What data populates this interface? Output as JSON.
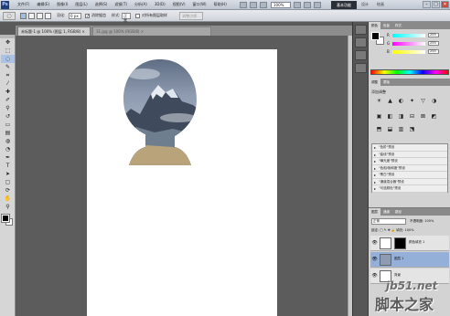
{
  "app": {
    "logo": "Ps",
    "menu": [
      "文件(F)",
      "编辑(E)",
      "图像(I)",
      "图层(L)",
      "选择(S)",
      "滤镜(T)",
      "分析(A)",
      "3D(D)",
      "视图(V)",
      "窗口(W)",
      "帮助(H)"
    ],
    "zoom": "100%",
    "workspace": "基本功能",
    "workspace_items": [
      "设计",
      "绘画"
    ],
    "window_controls": [
      "–",
      "□",
      "✕"
    ]
  },
  "options_bar": {
    "feather_label": "羽化:",
    "feather_value": "0 px",
    "antialias_label": "消除锯齿",
    "antialias_checked": true,
    "style_label": "样式:",
    "style_value": "正常",
    "autoselect_label": "对所有图层取样",
    "refine_edge": "调整边缘..."
  },
  "document_tabs": [
    {
      "label": "未标题-1 @ 100% (图层 1, RGB/8) ×",
      "active": true
    },
    {
      "label": "31.jpg @ 100% (RGB/8) ×",
      "active": false
    }
  ],
  "tools": [
    {
      "icon": "move-icon",
      "glyph": "✥"
    },
    {
      "icon": "marquee-icon",
      "glyph": "⬚"
    },
    {
      "icon": "lasso-icon",
      "glyph": "◌"
    },
    {
      "icon": "quick-select-icon",
      "glyph": "✎"
    },
    {
      "icon": "crop-icon",
      "glyph": "⌗"
    },
    {
      "icon": "eyedropper-icon",
      "glyph": "⁄"
    },
    {
      "icon": "healing-brush-icon",
      "glyph": "✚"
    },
    {
      "icon": "brush-icon",
      "glyph": "✐"
    },
    {
      "icon": "clone-stamp-icon",
      "glyph": "⚲"
    },
    {
      "icon": "history-brush-icon",
      "glyph": "↺"
    },
    {
      "icon": "eraser-icon",
      "glyph": "▭"
    },
    {
      "icon": "gradient-icon",
      "glyph": "▤"
    },
    {
      "icon": "blur-icon",
      "glyph": "◍"
    },
    {
      "icon": "dodge-icon",
      "glyph": "◔"
    },
    {
      "icon": "pen-icon",
      "glyph": "✒"
    },
    {
      "icon": "type-icon",
      "glyph": "T"
    },
    {
      "icon": "path-select-icon",
      "glyph": "➤"
    },
    {
      "icon": "shape-icon",
      "glyph": "▢"
    },
    {
      "icon": "3d-rotate-icon",
      "glyph": "⟳"
    },
    {
      "icon": "hand-icon",
      "glyph": "✋"
    },
    {
      "icon": "zoom-icon",
      "glyph": "⚲"
    }
  ],
  "color_panel": {
    "tabs": [
      "颜色",
      "色板",
      "样式"
    ],
    "sliders": [
      {
        "label": "R",
        "value": "255",
        "color": "#ff0000"
      },
      {
        "label": "G",
        "value": "255",
        "color": "#00ff00"
      },
      {
        "label": "B",
        "value": "255",
        "color": "#0000ff"
      }
    ]
  },
  "adjust_panel": {
    "tabs": [
      "调整",
      "蒙版"
    ],
    "title": "添加调整",
    "icons_row1": [
      "☀",
      "▲",
      "◐",
      "✦",
      "▽",
      "◑"
    ],
    "icons_row2": [
      "▣",
      "◧",
      "◨",
      "⊟",
      "⊠",
      "◩"
    ],
    "icons_row3": [
      "⬒",
      "⬓",
      "▥",
      "⬔"
    ],
    "presets": [
      "\"色阶\"预设",
      "\"曲线\"预设",
      "\"曝光度\"预设",
      "\"色相/饱和度\"预设",
      "\"黑白\"预设",
      "\"通道混合器\"预设",
      "\"可选颜色\"预设"
    ]
  },
  "layers_panel": {
    "tabs": [
      "图层",
      "通道",
      "路径"
    ],
    "blend_mode": "正常",
    "opacity_label": "不透明度: 100%",
    "lock_label": "锁定: □ ✎ ✥ 🔒   填充: 100%",
    "layers": [
      {
        "name": "颜色填充 1",
        "visible": true,
        "selected": false
      },
      {
        "name": "图层 1",
        "visible": true,
        "selected": true
      },
      {
        "name": "背景",
        "visible": true,
        "selected": false
      }
    ]
  },
  "watermark": {
    "url": "jb51.net",
    "name": "脚本之家"
  }
}
